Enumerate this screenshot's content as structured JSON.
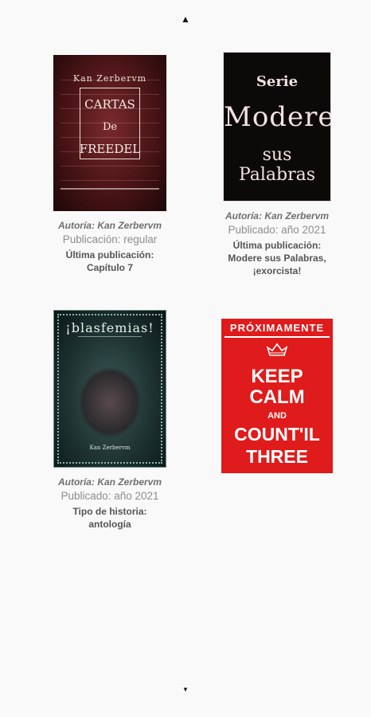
{
  "nav": {
    "up_arrow": "▲",
    "down_arrow": "▼"
  },
  "books": [
    {
      "cover": {
        "author": "Kan Zerbervm",
        "title_lines": [
          "CARTAS",
          "De",
          "FREEDEL"
        ],
        "accent_color": "#4a1416"
      },
      "author_label": "Autoría: Kan Zerbervm",
      "publication": "Publicación: regular",
      "last_label": "Última publicación:",
      "last_value": "Capítulo 7"
    },
    {
      "cover": {
        "serie": "Serie",
        "line1": "Modere",
        "line2": "sus Palabras",
        "accent_color": "#0c0909"
      },
      "author_label": "Autoría: Kan Zerbervm",
      "publication": "Publicado: año 2021",
      "last_label": "Última publicación:",
      "last_value": "Modere sus Palabras, ¡exorcista!"
    },
    {
      "cover": {
        "title": "¡blasfemias!",
        "author": "Kan Zerbervm",
        "accent_color": "#1d3231"
      },
      "author_label": "Autoría: Kan Zerbervm",
      "publication": "Publicado: año 2021",
      "last_label": "Tipo de historia:",
      "last_value": "antología"
    },
    {
      "cover": {
        "top": "PRÓXIMAMENTE",
        "keep": "KEEP",
        "calm": "CALM",
        "and": "AND",
        "count": "COUNT'IL",
        "three": "THREE",
        "accent_color": "#e01b1b"
      }
    }
  ]
}
